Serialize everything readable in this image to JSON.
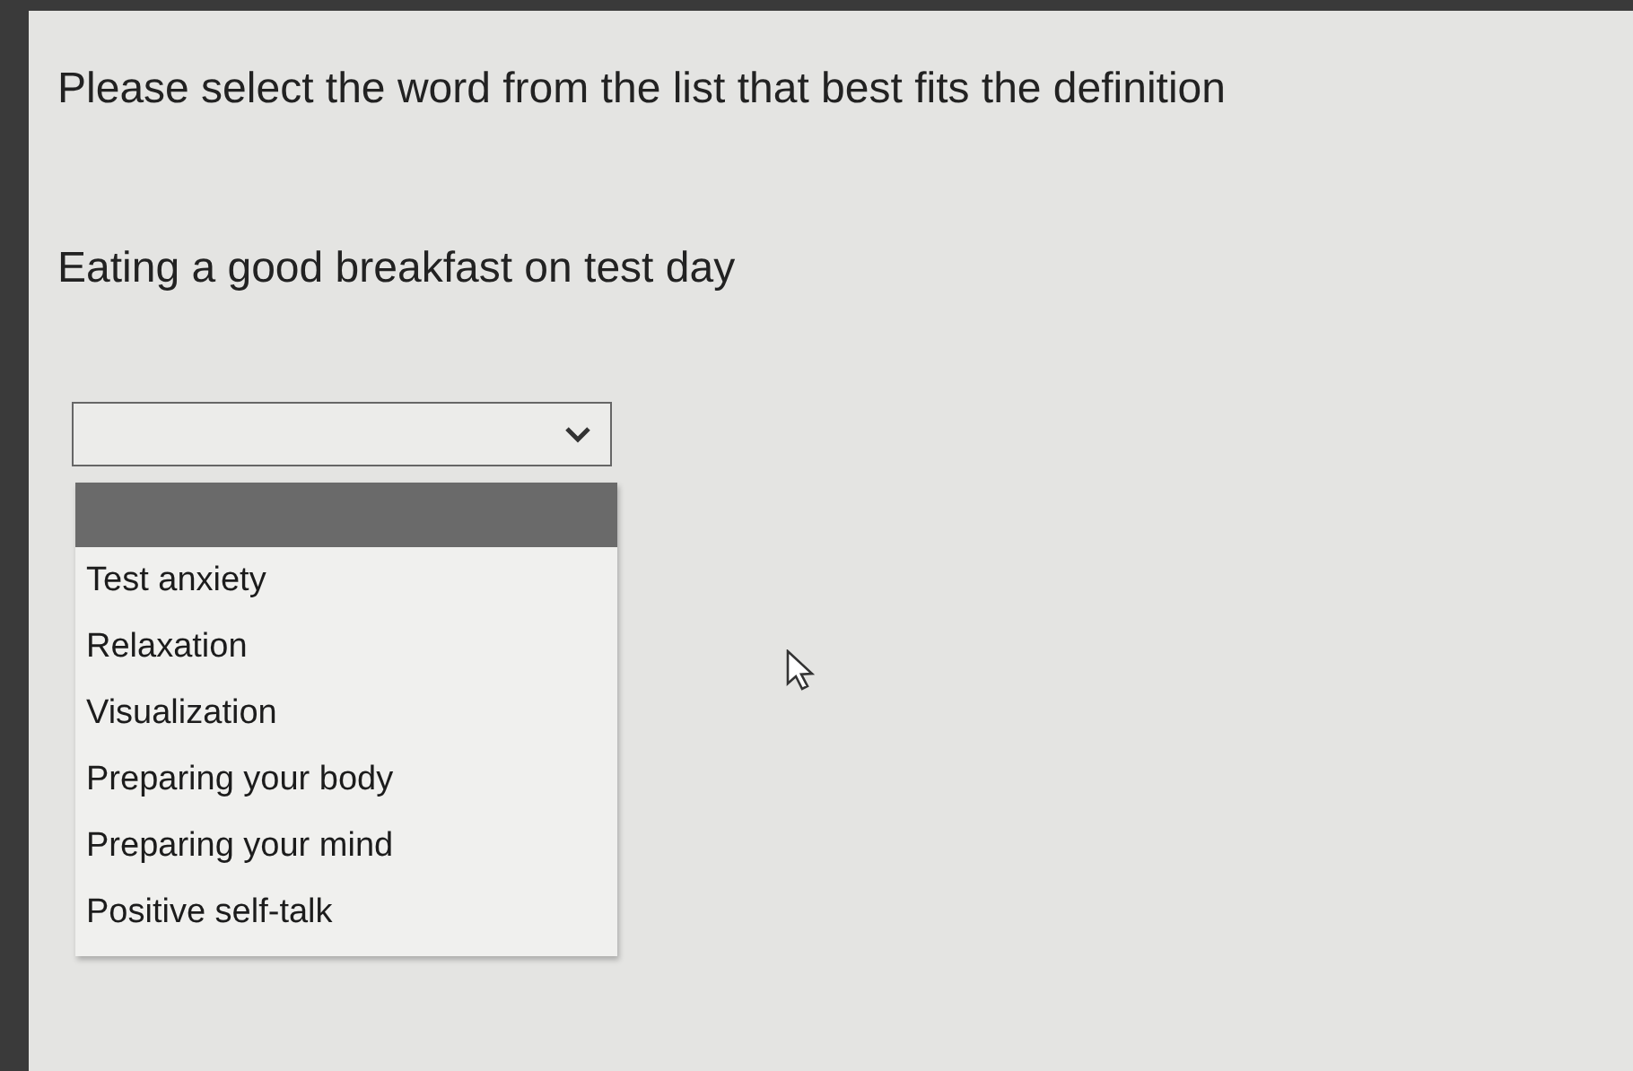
{
  "instruction": "Please select the word from the list that best fits the definition",
  "definition": "Eating a good breakfast on test day",
  "dropdown": {
    "expanded": true,
    "options": [
      {
        "kind": "blank",
        "selected": true
      },
      {
        "kind": "word",
        "label": "Test anxiety",
        "selected": false
      },
      {
        "kind": "word",
        "label": "Relaxation",
        "selected": false
      },
      {
        "kind": "word",
        "label": "Visualization",
        "selected": false
      },
      {
        "kind": "word",
        "label": "Preparing your body",
        "selected": false
      },
      {
        "kind": "word",
        "label": "Preparing your mind",
        "selected": false
      },
      {
        "kind": "word",
        "label": "Positive self-talk",
        "selected": false
      }
    ]
  }
}
